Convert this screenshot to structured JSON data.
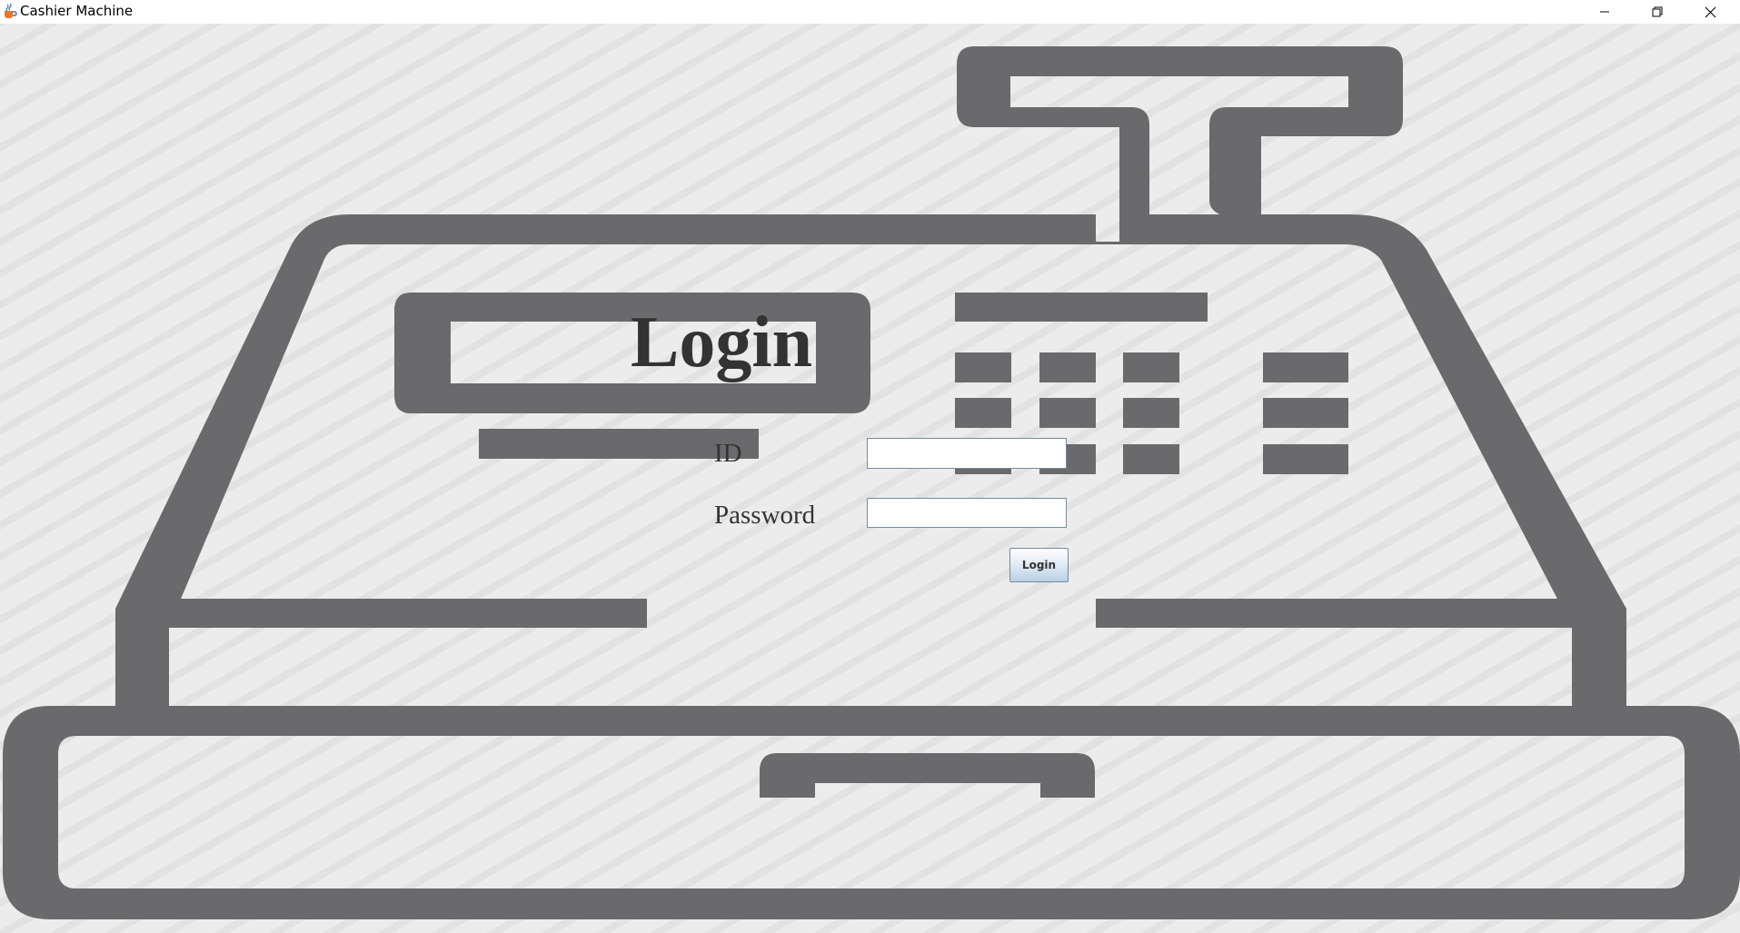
{
  "window": {
    "title": "Cashier Machine",
    "app_icon": "java-coffee-icon",
    "controls": [
      "minimize-icon",
      "restore-icon",
      "close-icon"
    ]
  },
  "form": {
    "heading": "Login",
    "id_label": "ID",
    "id_value": "",
    "password_label": "Password",
    "password_value": "",
    "submit_label": "Login"
  },
  "background": {
    "illustration": "cash-register-icon",
    "illustration_color": "#6a6a6c",
    "stripe_color": "#e2e2e2",
    "base_color": "#ececec"
  }
}
